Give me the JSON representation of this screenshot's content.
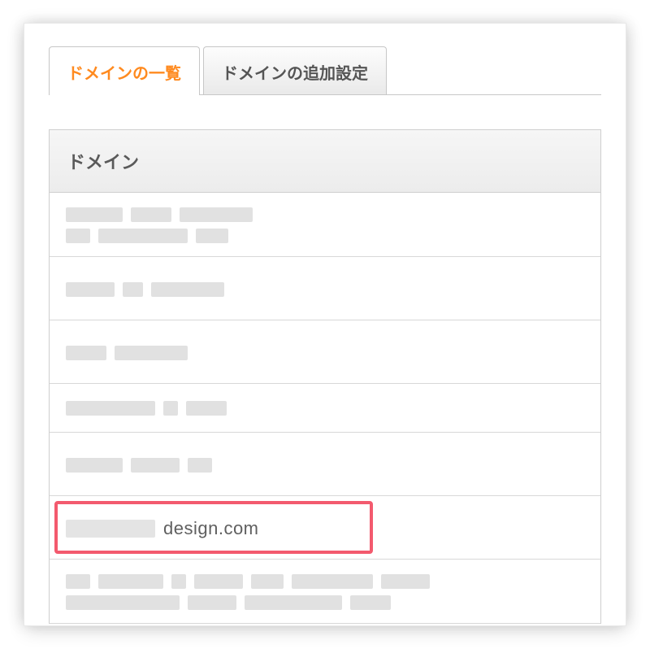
{
  "tabs": [
    {
      "label": "ドメインの一覧",
      "active": true
    },
    {
      "label": "ドメインの追加設定",
      "active": false
    }
  ],
  "table": {
    "header": "ドメイン",
    "rows": [
      {
        "redacted": true
      },
      {
        "redacted": true
      },
      {
        "redacted": true
      },
      {
        "redacted": true
      },
      {
        "redacted": true
      },
      {
        "redacted_prefix": true,
        "visible_suffix": "design.com",
        "highlighted": true
      },
      {
        "redacted": true
      }
    ]
  },
  "colors": {
    "accent": "#ff8a1f",
    "highlight_border": "#f35a6e"
  }
}
